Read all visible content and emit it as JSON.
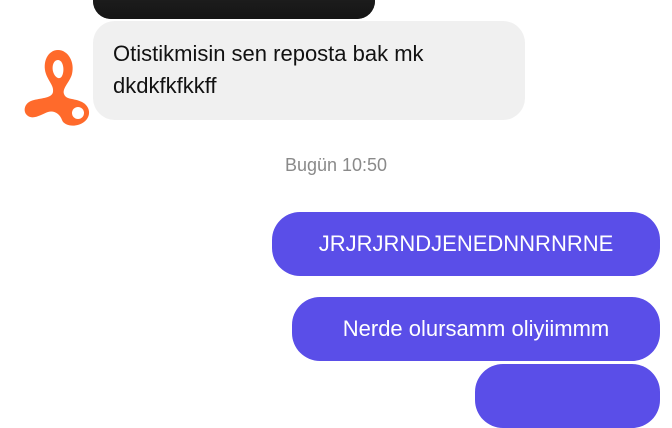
{
  "conversation": {
    "incoming_message": {
      "line1": "Otistikmisin sen reposta bak mk",
      "line2": "dkdkfkfkkff"
    },
    "timestamp": "Bugün 10:50",
    "outgoing_messages": [
      {
        "text": "JRJRJRNDJENEDNNRNRNE"
      },
      {
        "text": "Nerde olursamm oliyiimmm"
      },
      {
        "text": ""
      }
    ],
    "colors": {
      "outgoing_bubble": "#5a4ee8",
      "incoming_bubble": "#f0f0f0",
      "avatar": "#ff6a2b",
      "timestamp": "#8a8a8a"
    },
    "icons": {
      "avatar": "orange-scribble-avatar-icon"
    }
  }
}
